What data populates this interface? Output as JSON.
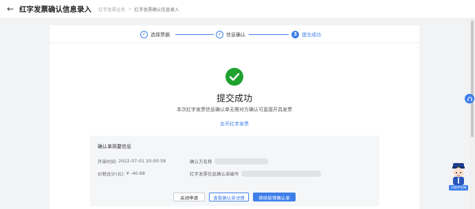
{
  "header": {
    "back_icon": "arrow-left-icon",
    "title": "红字发票确认信息录入",
    "breadcrumb": [
      "红字发票业务",
      "红字发票确认信息录入"
    ],
    "breadcrumb_sep": ">"
  },
  "steps": [
    {
      "label": "选择票据",
      "state": "done",
      "icon": "check-circle-icon"
    },
    {
      "label": "信息确认",
      "state": "done",
      "icon": "check-circle-icon"
    },
    {
      "label": "提交成功",
      "state": "active",
      "number": "3"
    }
  ],
  "result": {
    "icon": "success-check-icon",
    "title": "提交成功",
    "description": "本次红字发票信息确认单无需对方确认可直接开具发票",
    "link": "去开红字发票"
  },
  "summary": {
    "title": "确认单简要信息",
    "open_time_label": "开单时间:",
    "open_time_value": "2022-07-01 20:00:58",
    "amount_label": "价税合计(元):",
    "amount_value": "¥ -40.68",
    "party_label": "确认方名称",
    "number_label": "红字发票信息确认单编号"
  },
  "buttons": {
    "close": "关闭申请",
    "view": "查看确认单详情",
    "new": "继续新增确认单"
  },
  "assistant": {
    "label": "小助手在线"
  },
  "colors": {
    "accent": "#3d7eea",
    "success": "#1fa22e"
  }
}
